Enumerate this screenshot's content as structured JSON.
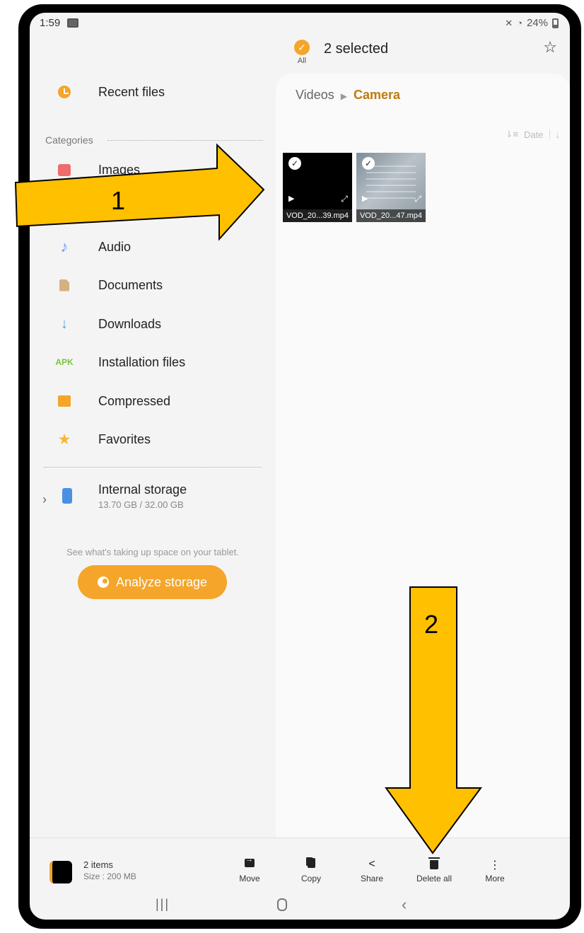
{
  "status_bar": {
    "time": "1:59",
    "battery": "24%"
  },
  "header": {
    "select_all_label": "All",
    "selected_count": "2 selected"
  },
  "sidebar": {
    "recent": "Recent files",
    "categories_label": "Categories",
    "items": [
      {
        "label": "Images",
        "icon": "image-icon"
      },
      {
        "label": "Audio",
        "icon": "music-note-icon"
      },
      {
        "label": "Documents",
        "icon": "document-icon"
      },
      {
        "label": "Downloads",
        "icon": "download-icon"
      },
      {
        "label": "Installation files",
        "icon": "apk-icon",
        "icon_text": "APK"
      },
      {
        "label": "Compressed",
        "icon": "zip-icon"
      },
      {
        "label": "Favorites",
        "icon": "star-icon"
      }
    ],
    "storage": {
      "title": "Internal storage",
      "size": "13.70 GB / 32.00 GB"
    },
    "analyze_hint": "See what's taking up space on your tablet.",
    "analyze_button": "Analyze storage"
  },
  "content": {
    "breadcrumb": {
      "parent": "Videos",
      "current": "Camera"
    },
    "sort_label": "Date",
    "files": [
      {
        "name": "VOD_20...39.mp4",
        "selected": true
      },
      {
        "name": "VOD_20...47.mp4",
        "selected": true
      }
    ]
  },
  "bottom_bar": {
    "items_count": "2 items",
    "size": "Size : 200 MB",
    "actions": [
      "Move",
      "Copy",
      "Share",
      "Delete all",
      "More"
    ]
  },
  "annotations": {
    "arrow_1": "1",
    "arrow_2": "2",
    "arrow_color": "#FFC000"
  },
  "colors": {
    "accent": "#f4a52a",
    "breadcrumb_current": "#c07a0c"
  }
}
